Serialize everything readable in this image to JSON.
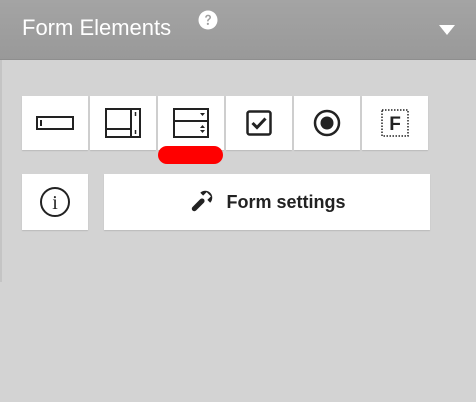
{
  "header": {
    "title": "Form Elements",
    "help_icon": "question-circle-icon",
    "collapse_icon": "caret-down-icon"
  },
  "toolbar": {
    "items": [
      {
        "icon": "text-field-icon"
      },
      {
        "icon": "textarea-icon"
      },
      {
        "icon": "select-dropdown-icon"
      },
      {
        "icon": "checkbox-icon"
      },
      {
        "icon": "radio-button-icon"
      },
      {
        "icon": "fieldset-icon",
        "glyph": "F"
      }
    ]
  },
  "actions": {
    "info_icon": "info-icon",
    "info_glyph": "i",
    "settings_icon": "wrench-icon",
    "settings_label": "Form settings"
  },
  "colors": {
    "background": "#d3d3d3",
    "header": "#9f9f9f",
    "marker": "#ff0000",
    "button": "#ffffff"
  }
}
